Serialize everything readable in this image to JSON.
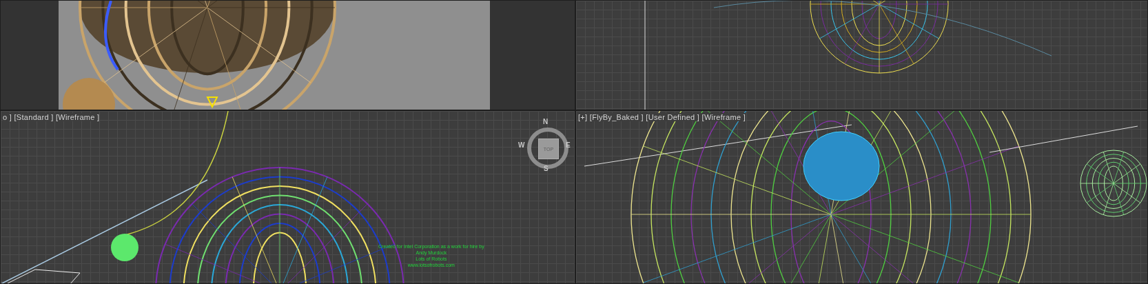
{
  "viewports": [
    {
      "kind": "render"
    },
    {
      "kind": "wireframe"
    },
    {
      "kind": "wireframe",
      "label": "o ] [Standard ] [Wireframe ]",
      "view_cube": {
        "top": "TOP",
        "north": "N",
        "south": "S",
        "east": "E",
        "west": "W"
      },
      "credits": [
        "Created for Intel Corporation as a work for hire by",
        "Andy Murdock",
        "Lots of Robots",
        "www.lotsofrobots.com"
      ]
    },
    {
      "kind": "wireframe",
      "label": "[+] [FlyBy_Baked ] [User Defined ] [Wireframe ]"
    }
  ]
}
